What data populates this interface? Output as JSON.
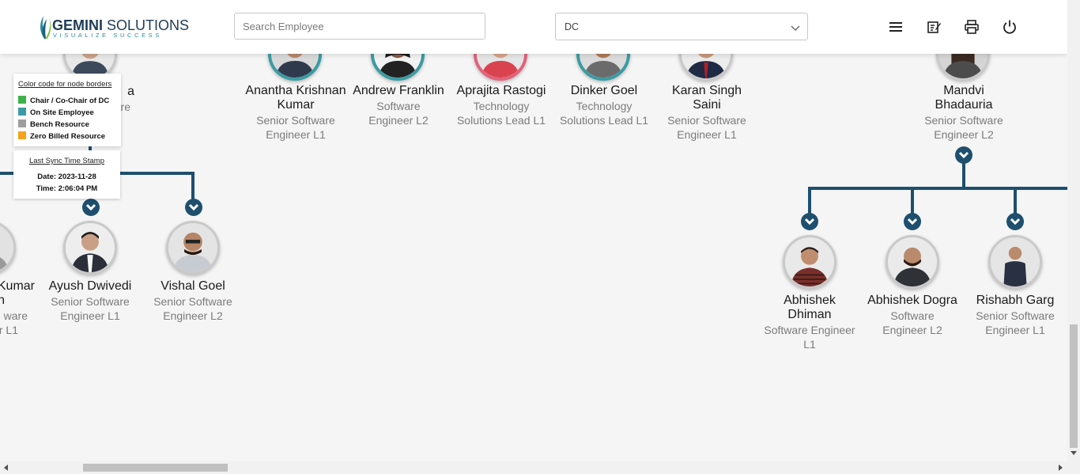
{
  "header": {
    "brand_bold": "GEMINI",
    "brand_rest": " SOLUTIONS",
    "tagline": "VISUALIZE SUCCESS",
    "search_placeholder": "Search Employee",
    "dept_selected": "DC",
    "icons": [
      "menu-icon",
      "edit-note-icon",
      "print-icon",
      "power-icon"
    ]
  },
  "legend": {
    "title": "Color code for node borders",
    "items": [
      {
        "label": "Chair / Co-Chair of DC",
        "color": "#3db24a"
      },
      {
        "label": "On Site Employee",
        "color": "#3a9ca3"
      },
      {
        "label": "Bench Resource",
        "color": "#9e9e9e"
      },
      {
        "label": "Zero Billed Resource",
        "color": "#f5a31a"
      }
    ]
  },
  "sync": {
    "title": "Last Sync Time Stamp",
    "date": "Date: 2023-11-28",
    "time": "Time: 2:06:04 PM"
  },
  "partial_top_left": {
    "name_fragment": "a",
    "role_fragment": "re"
  },
  "top_row": [
    {
      "name": "Anantha Krishnan Kumar",
      "role": "Senior Software Engineer L1"
    },
    {
      "name": "Andrew Franklin",
      "role": "Software Engineer L2"
    },
    {
      "name": "Aprajita Rastogi",
      "role": "Technology Solutions Lead L1"
    },
    {
      "name": "Dinker Goel",
      "role": "Technology Solutions Lead L1"
    },
    {
      "name": "Karan Singh Saini",
      "role": "Senior Software Engineer L1"
    },
    {
      "name": "Mandvi Bhadauria",
      "role": "Senior Software Engineer L2"
    }
  ],
  "left_children": [
    {
      "name_fragment": "Kumar",
      "extra_fragment": "n",
      "role_fragment1": "ware",
      "role_fragment2": "r L1"
    },
    {
      "name": "Ayush Dwivedi",
      "role": "Senior Software Engineer L1"
    },
    {
      "name": "Vishal Goel",
      "role": "Senior Software Engineer L2"
    }
  ],
  "right_children": [
    {
      "name": "Abhishek Dhiman",
      "role": "Software Engineer L1"
    },
    {
      "name": "Abhishek Dogra",
      "role": "Software Engineer L2"
    },
    {
      "name": "Rishabh Garg",
      "role": "Senior Software Engineer L1"
    }
  ]
}
